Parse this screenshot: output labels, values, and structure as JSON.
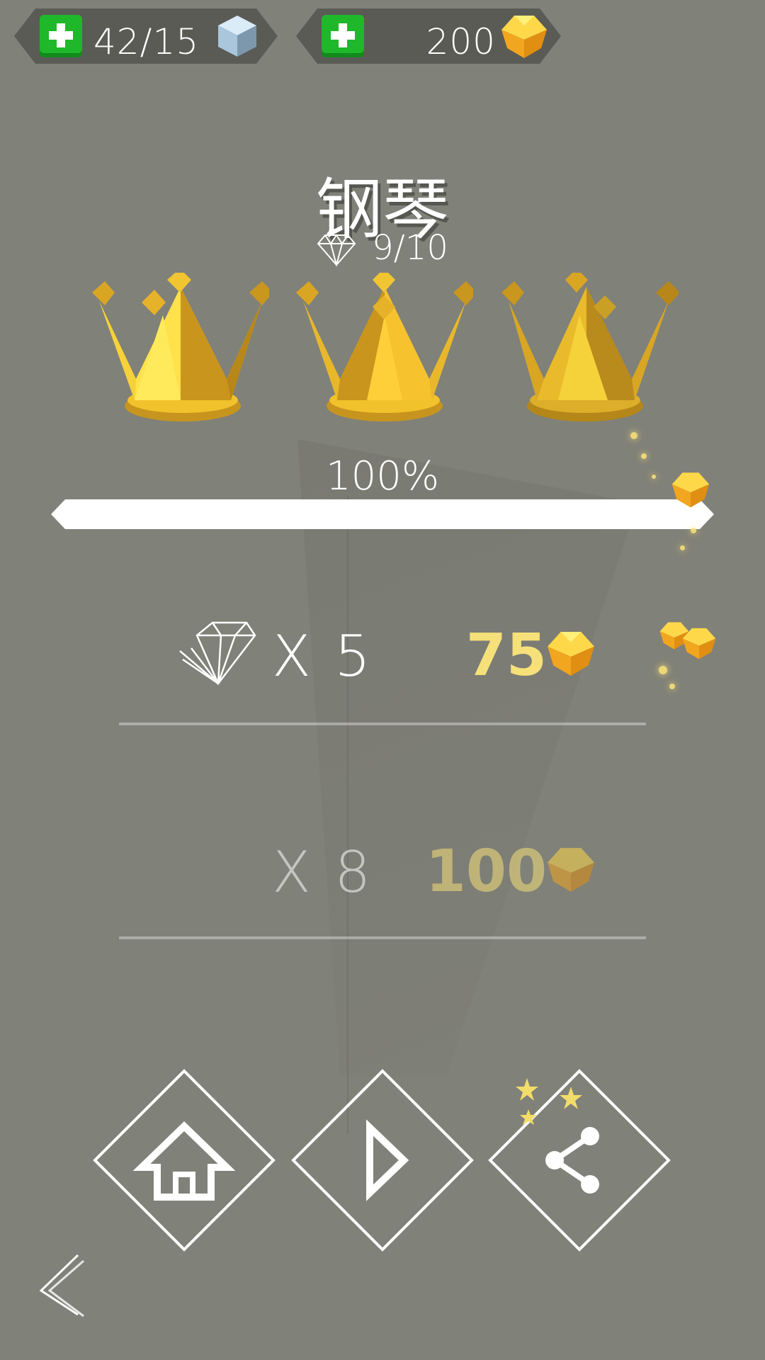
{
  "currencies": {
    "cubes": {
      "value": "42/15",
      "icon": "cube-icon",
      "add_icon": "plus-icon"
    },
    "gems": {
      "value": "200",
      "icon": "gold-gem-icon",
      "add_icon": "plus-icon"
    }
  },
  "level": {
    "title": "钢琴",
    "diamonds": "9/10",
    "crowns_earned": 3,
    "progress_label": "100%",
    "progress": 1.0
  },
  "rewards": [
    {
      "multiplier": "X 5",
      "amount": "75",
      "icon": "gold-gem-icon"
    },
    {
      "multiplier": "X 8",
      "amount": "100",
      "icon": "gold-gem-icon"
    }
  ],
  "nav": {
    "home_icon": "home-icon",
    "play_icon": "play-icon",
    "share_icon": "share-icon",
    "back_icon": "back-chevron-icon"
  },
  "colors": {
    "background": "#808178",
    "counter_bg": "#5a5b55",
    "plus_green": "#1fb82b",
    "gold": "#f6e07a",
    "crown_gold": "#e8b82a"
  }
}
